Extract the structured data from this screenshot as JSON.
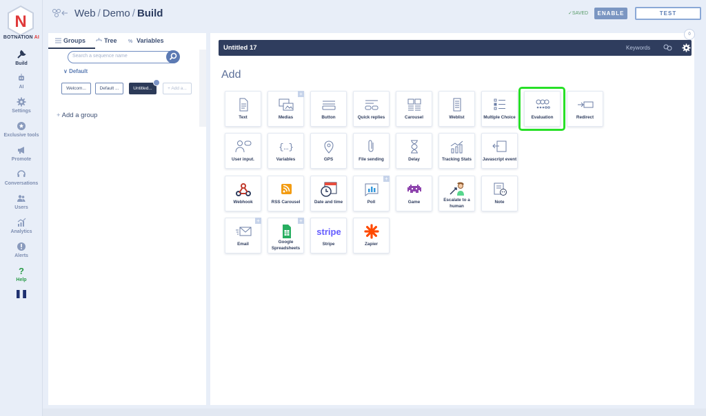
{
  "brand": {
    "name_dark": "BOTNATION",
    "name_red": " AI"
  },
  "nav": [
    {
      "label": "Build",
      "icon": "wrench-icon",
      "active": true
    },
    {
      "label": "AI",
      "icon": "robot-icon"
    },
    {
      "label": "Settings",
      "icon": "gear-icon"
    },
    {
      "label": "Exclusive tools",
      "icon": "star-icon"
    },
    {
      "label": "Promote",
      "icon": "megaphone-icon"
    },
    {
      "label": "Conversations",
      "icon": "headset-icon"
    },
    {
      "label": "Users",
      "icon": "users-icon"
    },
    {
      "label": "Analytics",
      "icon": "analytics-icon"
    },
    {
      "label": "Alerts",
      "icon": "alert-icon"
    },
    {
      "label": "Help",
      "icon": "help-icon"
    }
  ],
  "breadcrumb": {
    "part1": "Web",
    "part2": "Demo",
    "part3": "Build"
  },
  "topbar": {
    "saved": "SAVED",
    "enable": "ENABLE",
    "test": "TEST"
  },
  "left_panel": {
    "tabs": [
      "Groups",
      "Tree",
      "Variables"
    ],
    "search_placeholder": "Search a sequence name",
    "group_name": "Default",
    "sequences": [
      "Welcom...",
      "Default ...",
      "Untitled...",
      "Add a..."
    ],
    "add_group": "Add a group"
  },
  "main": {
    "title": "Untitled 17",
    "keywords": "Keywords",
    "counter": "0",
    "add_heading": "Add",
    "highlighted_block": "Evaluation"
  },
  "blocks": [
    [
      "Text",
      "Medias",
      "Button",
      "Quick replies",
      "Carousel",
      "Weblist",
      "Multiple Choice",
      "Evaluation",
      "Redirect"
    ],
    [
      "User input.",
      "Variables",
      "GPS",
      "File sending",
      "Delay",
      "Tracking Stats",
      "Javascript event"
    ],
    [
      "Webhook",
      "RSS Carousel",
      "Date and time",
      "Poll",
      "Game",
      "Escalate to a human",
      "Note"
    ],
    [
      "Email",
      "Google Spreadsheets",
      "Stripe",
      "Zapier"
    ]
  ],
  "stripe_logo": "stripe",
  "colors": {
    "accent": "#2f3d5e",
    "highlight": "#27e027",
    "rail_bg": "#e8eef8"
  }
}
